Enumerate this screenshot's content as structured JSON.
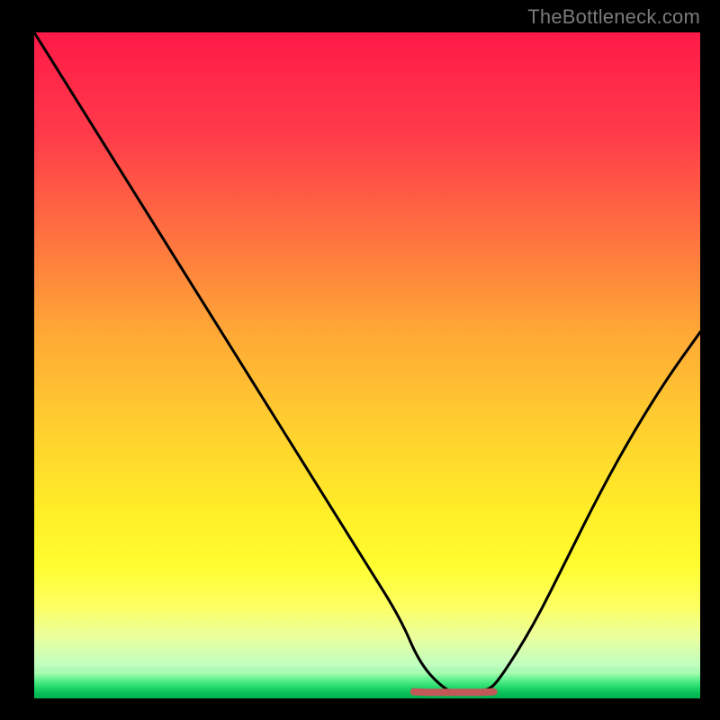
{
  "watermark": "TheBottleneck.com",
  "chart_data": {
    "type": "line",
    "title": "",
    "xlabel": "",
    "ylabel": "",
    "xlim": [
      0,
      100
    ],
    "ylim": [
      0,
      100
    ],
    "grid": false,
    "background": "heatmap-gradient red→yellow→light-yellow→green",
    "series": [
      {
        "name": "bottleneck-curve",
        "color": "#000000",
        "x": [
          0,
          5,
          10,
          15,
          20,
          25,
          30,
          35,
          40,
          45,
          50,
          55,
          58,
          62,
          64,
          68,
          70,
          75,
          80,
          85,
          90,
          95,
          100
        ],
        "y": [
          100,
          92,
          84,
          76,
          68,
          60,
          52,
          44,
          36,
          28,
          20,
          12,
          5,
          1,
          1,
          1,
          3,
          11,
          21,
          31,
          40,
          48,
          55
        ]
      },
      {
        "name": "optimal-flat-region",
        "color": "#c25858",
        "x": [
          57,
          59,
          61,
          63,
          65,
          67,
          69
        ],
        "y": [
          1.0,
          0.9,
          0.9,
          0.9,
          0.9,
          0.9,
          1.0
        ]
      }
    ]
  }
}
